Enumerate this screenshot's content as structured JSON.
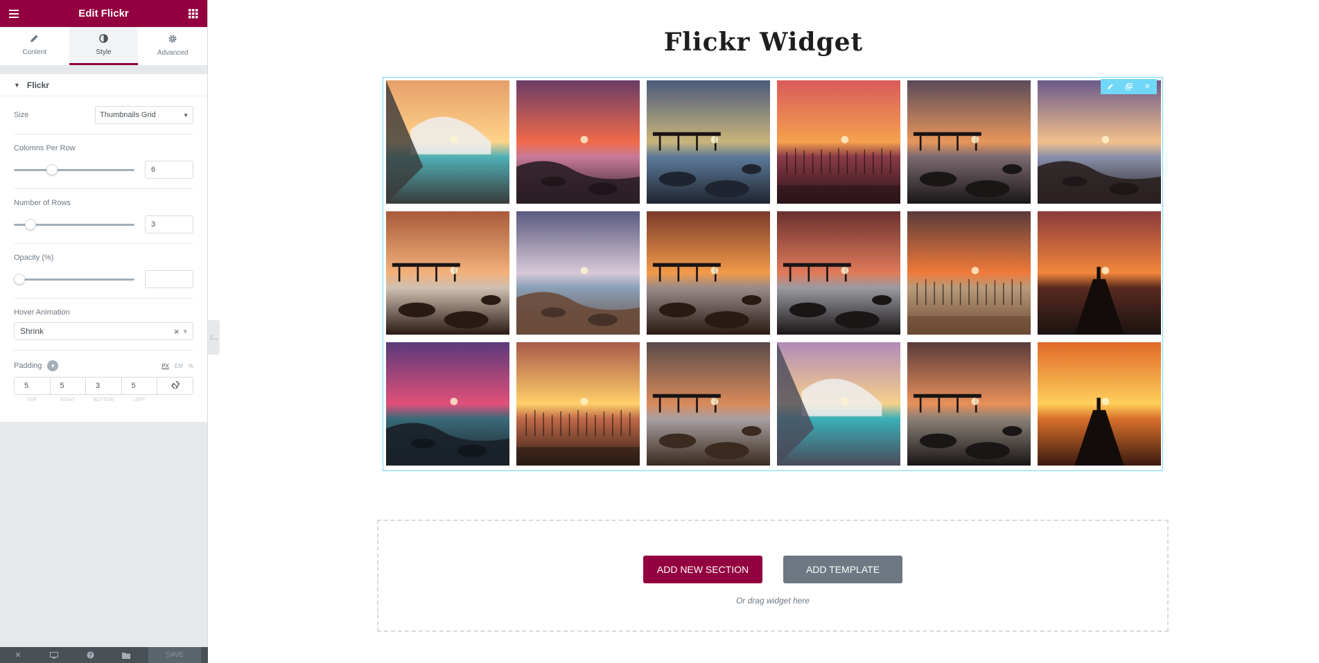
{
  "panel": {
    "title": "Edit Flickr",
    "tabs": [
      {
        "label": "Content",
        "icon": "pencil-icon"
      },
      {
        "label": "Style",
        "icon": "half-circle-icon"
      },
      {
        "label": "Advanced",
        "icon": "gear-icon"
      }
    ],
    "section": "Flickr",
    "controls": {
      "size": {
        "label": "Size",
        "value": "Thumbnails Grid"
      },
      "columns": {
        "label": "Colomns Per Row",
        "value": "6",
        "fraction": 0.3
      },
      "rows": {
        "label": "Number of Rows",
        "value": "3",
        "fraction": 0.1
      },
      "opacity": {
        "label": "Opacity (%)",
        "value": "",
        "fraction": 0.0
      },
      "hover": {
        "label": "Hover Animation",
        "value": "Shrink",
        "clear": "×",
        "caret": "▾"
      },
      "padding": {
        "label": "Padding",
        "units": [
          "PX",
          "EM",
          "%"
        ],
        "values": [
          "5",
          "5",
          "3",
          "5"
        ],
        "sides": [
          "TOP",
          "RIGHT",
          "BOTTOM",
          "LEFT"
        ]
      }
    },
    "footer": {
      "save": "SAVE"
    },
    "handle": "⁝..."
  },
  "preview": {
    "title": "Flickr Widget",
    "add_section": "ADD NEW SECTION",
    "add_template": "ADD TEMPLATE",
    "drag_hint": "Or drag widget here"
  },
  "colors": {
    "brand": "#93003f",
    "widget_border": "#71d7f7",
    "template_btn": "#6d7882"
  },
  "thumbnails": [
    {
      "sky": "#e6a06a",
      "sun": "#ffd38a",
      "water": "#4fb0b5",
      "ground": "#3a3a3a",
      "kind": "building"
    },
    {
      "sky": "#6a3c66",
      "sun": "#f06a4a",
      "water": "#c87a98",
      "ground": "#2a1e25",
      "kind": "shore"
    },
    {
      "sky": "#4a5a7c",
      "sun": "#c9b57a",
      "water": "#5d7a9a",
      "ground": "#1f2530",
      "kind": "pier"
    },
    {
      "sky": "#d95a5a",
      "sun": "#f5a14e",
      "water": "#8a3a48",
      "ground": "#2a1418",
      "kind": "reeds"
    },
    {
      "sky": "#5a4a5a",
      "sun": "#e8965a",
      "water": "#7a6a70",
      "ground": "#1a1616",
      "kind": "pier"
    },
    {
      "sky": "#6a5a8a",
      "sun": "#f2c08a",
      "water": "#8a90aa",
      "ground": "#2a2020",
      "kind": "shore"
    },
    {
      "sky": "#a85a3a",
      "sun": "#f2b07a",
      "water": "#cfc0b0",
      "ground": "#2a1a14",
      "kind": "pier"
    },
    {
      "sky": "#5a5a80",
      "sun": "#d8c8d8",
      "water": "#8aa0b8",
      "ground": "#6a4a3a",
      "kind": "shore"
    },
    {
      "sky": "#7a3a2a",
      "sun": "#f29a4a",
      "water": "#9a8a8a",
      "ground": "#2a1a14",
      "kind": "pier"
    },
    {
      "sky": "#6a3030",
      "sun": "#e07a5a",
      "water": "#9a9aa0",
      "ground": "#1a1616",
      "kind": "pier"
    },
    {
      "sky": "#5a3a3a",
      "sun": "#f07a3a",
      "water": "#b89a7a",
      "ground": "#6a4a34",
      "kind": "reeds"
    },
    {
      "sky": "#8a3a3a",
      "sun": "#f2863a",
      "water": "#5a2a20",
      "ground": "#1a1210",
      "kind": "dock"
    },
    {
      "sky": "#5a3a7a",
      "sun": "#e0507a",
      "water": "#3a6a78",
      "ground": "#1a2028",
      "kind": "shore"
    },
    {
      "sky": "#a85a4a",
      "sun": "#ffcf6a",
      "water": "#c06a48",
      "ground": "#2a1a14",
      "kind": "reeds"
    },
    {
      "sky": "#5a4a4a",
      "sun": "#d88a5a",
      "water": "#a8a0a0",
      "ground": "#3a2a20",
      "kind": "pier"
    },
    {
      "sky": "#b08ab8",
      "sun": "#f6d08a",
      "water": "#3ab0b8",
      "ground": "#4a4a5a",
      "kind": "building"
    },
    {
      "sky": "#5a3a3a",
      "sun": "#e8905a",
      "water": "#8a8078",
      "ground": "#1a1616",
      "kind": "pier"
    },
    {
      "sky": "#e06a2a",
      "sun": "#ffcf5a",
      "water": "#d8702a",
      "ground": "#3a1a10",
      "kind": "dock"
    }
  ]
}
